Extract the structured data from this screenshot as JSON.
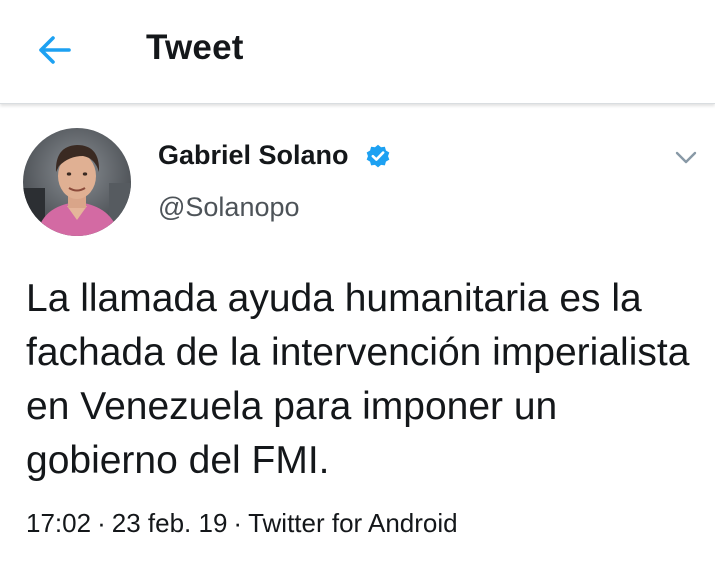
{
  "header": {
    "back_icon": "arrow-left-icon",
    "title": "Tweet"
  },
  "tweet": {
    "author": {
      "name": "Gabriel Solano",
      "handle": "@Solanopo",
      "verified": true,
      "verified_icon": "verified-badge-icon"
    },
    "menu_icon": "chevron-down-icon",
    "text": "La llamada ayuda humanitaria es la fachada de la intervención imperialista en Venezuela para imponer un gobierno del FMI.",
    "time": "17:02",
    "date": "23 feb. 19",
    "source": "Twitter for Android",
    "separator": "·"
  },
  "colors": {
    "accent": "#1da1f2",
    "text": "#14171a",
    "secondary": "#4d5358",
    "divider": "#d9dde0"
  }
}
